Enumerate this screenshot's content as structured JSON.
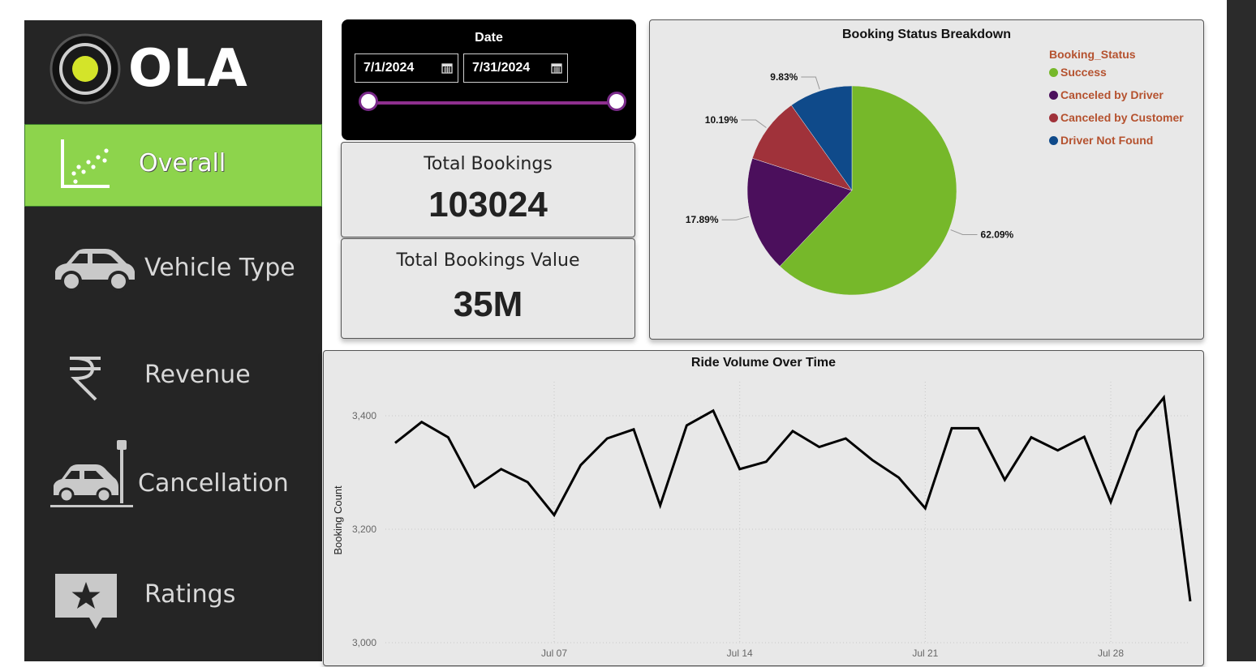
{
  "app": {
    "logo_text": "OLA",
    "nav": [
      {
        "label": "Overall",
        "icon": "scatter-chart-icon",
        "active": true
      },
      {
        "label": "Vehicle Type",
        "icon": "car-icon",
        "active": false
      },
      {
        "label": "Revenue",
        "icon": "rupee-icon",
        "active": false
      },
      {
        "label": "Cancellation",
        "icon": "car-crash-icon",
        "active": false
      },
      {
        "label": "Ratings",
        "icon": "star-comment-icon",
        "active": false
      }
    ]
  },
  "date_filter": {
    "title": "Date",
    "start": "7/1/2024",
    "end": "7/31/2024"
  },
  "kpis": {
    "total_bookings_label": "Total Bookings",
    "total_bookings_value": "103024",
    "total_value_label": "Total Bookings Value",
    "total_value_value": "35M"
  },
  "colors": {
    "accent_green": "#8dd44c",
    "sidebar_bg": "#252525",
    "slider": "#8e2f8e",
    "legend_text": "#b5522f"
  },
  "chart_data": [
    {
      "type": "pie",
      "title": "Booking Status Breakdown",
      "legend_title": "Booking_Status",
      "legend_position": "top-right",
      "slices": [
        {
          "label": "Success",
          "value": 62.09,
          "display": "62.09%",
          "color": "#76b82a"
        },
        {
          "label": "Canceled by Driver",
          "value": 17.89,
          "display": "17.89%",
          "color": "#4b0f5c"
        },
        {
          "label": "Canceled by Customer",
          "value": 10.19,
          "display": "10.19%",
          "color": "#a0323a"
        },
        {
          "label": "Driver Not Found",
          "value": 9.83,
          "display": "9.83%",
          "color": "#0f4a8a"
        }
      ]
    },
    {
      "type": "line",
      "title": "Ride Volume Over Time",
      "xlabel": "",
      "ylabel": "Booking Count",
      "ylim": [
        3000,
        3460
      ],
      "yticks": [
        3000,
        3200,
        3400
      ],
      "ytick_labels": [
        "3,000",
        "3,200",
        "3,400"
      ],
      "xtick_labels": [
        "Jul 07",
        "Jul 14",
        "Jul 21",
        "Jul 28"
      ],
      "xtick_days": [
        7,
        14,
        21,
        28
      ],
      "grid": true,
      "x": [
        1,
        2,
        3,
        4,
        5,
        6,
        7,
        8,
        9,
        10,
        11,
        12,
        13,
        14,
        15,
        16,
        17,
        18,
        19,
        20,
        21,
        22,
        23,
        24,
        25,
        26,
        27,
        28,
        29,
        30,
        31
      ],
      "y": [
        3352,
        3389,
        3362,
        3274,
        3306,
        3283,
        3225,
        3313,
        3360,
        3376,
        3242,
        3383,
        3409,
        3306,
        3319,
        3373,
        3345,
        3360,
        3322,
        3291,
        3237,
        3378,
        3378,
        3287,
        3362,
        3339,
        3363,
        3248,
        3373,
        3432,
        3073
      ]
    }
  ]
}
